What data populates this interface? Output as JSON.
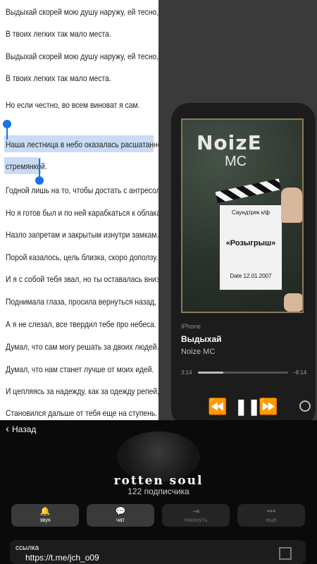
{
  "lyrics": [
    "Выдыхай скорей мою душу наружу, ей тесно,",
    "В твоих легких так мало места.",
    "Выдыхай скорей мою душу наружу, ей тесно,",
    "В твоих легких так мало места.",
    "Но если честно, во всем виноват я сам.",
    "Наша лестница в небо оказалась расшатанной",
    "стремянкой.",
    "Годной лишь на то, чтобы достать с антресоли банку.",
    "Но я готов был и по ней карабкаться к облакам",
    "Назло запретам и закрытым изнутри замкам.",
    "Порой казалось, цель близка, скоро доползу.",
    "И я с собой тебя звал, но ты оставалась внизу.",
    "Поднимала глаза, просила вернуться назад,",
    "А я не слезал, все твердил тебе про небеса.",
    "Думал, что сам могу решать за двоих людей.",
    "Думал, что нам станет лучше от моих идей.",
    "И цепляясь за надежду, как за одежду репей,",
    "Становился дальше от тебя еще на ступень."
  ],
  "player": {
    "cover_title": "NoizE",
    "cover_subtitle": "MC",
    "clapper_lines": [
      "Саундтрек к/ф",
      "«Розыгрыш»",
      "Date 12.01.2007"
    ],
    "source": "iPhone",
    "song": "Выдыхай",
    "artist": "Noize MC",
    "elapsed": "3:14",
    "remaining": "−8:14",
    "progress": 0.28,
    "prev_icon": "⏪",
    "play_icon": "❚❚",
    "next_icon": "⏩"
  },
  "channel": {
    "back_label": "Назад",
    "name": "rotten soul",
    "subscribers": "122 подписчика",
    "buttons": [
      {
        "label": "звук",
        "icon": "🔔"
      },
      {
        "label": "чат",
        "icon": "💬"
      },
      {
        "label": "покинуть",
        "icon": "⇥"
      },
      {
        "label": "ещё",
        "icon": "•••"
      }
    ],
    "link_label": "ссылка",
    "link_url": "https://t.me/jch_o09"
  },
  "colors": {
    "selection": "#c9dcf5",
    "handle": "#1a73e8"
  }
}
